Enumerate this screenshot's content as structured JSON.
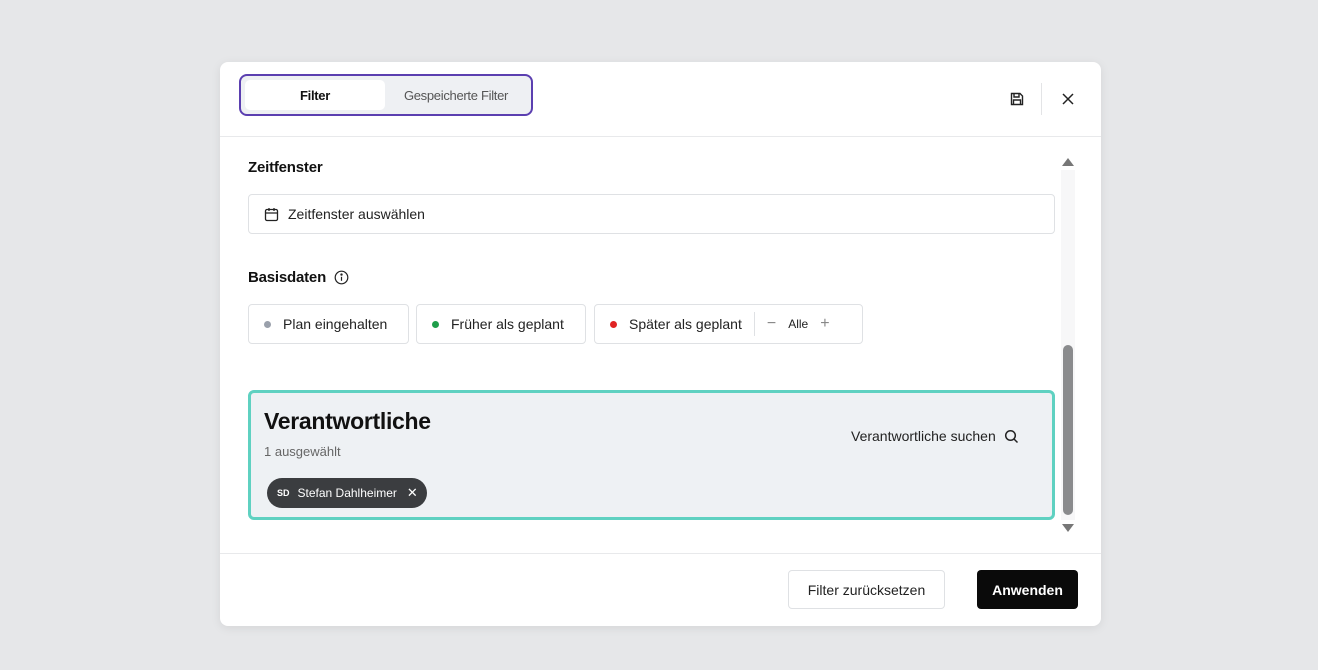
{
  "tabs": {
    "filter": "Filter",
    "saved": "Gespeicherte Filter"
  },
  "header_icons": {
    "save": "save-icon",
    "close": "close-icon"
  },
  "zeitfenster": {
    "title": "Zeitfenster",
    "placeholder": "Zeitfenster auswählen"
  },
  "basisdaten": {
    "title": "Basisdaten",
    "chips": [
      {
        "label": "Plan eingehalten",
        "color": "#9aa0ab"
      },
      {
        "label": "Früher als geplant",
        "color": "#1e9e4a"
      },
      {
        "label": "Später als geplant",
        "color": "#e02424"
      }
    ],
    "range_label": "Alle"
  },
  "verantwortliche": {
    "title": "Verantwortliche",
    "subtitle": "1 ausgewählt",
    "search_label": "Verantwortliche suchen",
    "person": {
      "initials": "SD",
      "name": "Stefan Dahlheimer"
    }
  },
  "footer": {
    "reset": "Filter zurücksetzen",
    "apply": "Anwenden"
  },
  "colors": {
    "tab_outline": "#5b3fb0",
    "section_highlight": "#5fd1c1"
  }
}
